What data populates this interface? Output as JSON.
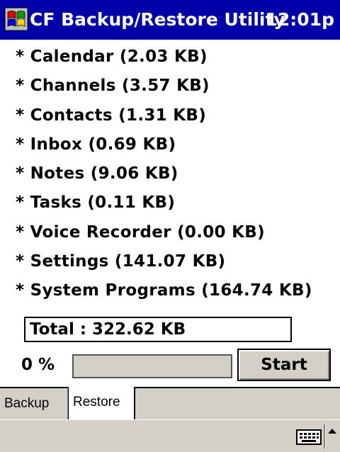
{
  "titlebar": {
    "app_title": "CF Backup/Restore Utility",
    "clock": "12:01p"
  },
  "items": [
    "* Calendar (2.03 KB)",
    "* Channels (3.57 KB)",
    "* Contacts (1.31 KB)",
    "* Inbox (0.69 KB)",
    "* Notes (9.06 KB)",
    "* Tasks (0.11 KB)",
    "* Voice Recorder (0.00 KB)",
    "* Settings (141.07 KB)",
    "* System Programs (164.74 KB)"
  ],
  "total": {
    "label": "Total :  322.62 KB"
  },
  "progress": {
    "label": "0 %",
    "value": 0
  },
  "buttons": {
    "start": "Start"
  },
  "tabs": {
    "backup": "Backup",
    "restore": "Restore",
    "active": "Restore"
  },
  "icons": {
    "logo": "windows-flag-icon",
    "keyboard": "keyboard-icon",
    "sip": "sip-arrow-icon"
  },
  "colors": {
    "title_bg": "#0000a8",
    "chrome": "#d4d0c8"
  }
}
